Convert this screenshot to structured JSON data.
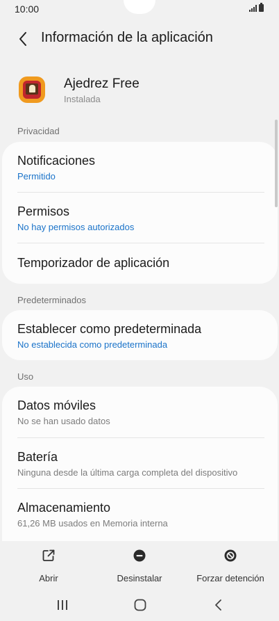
{
  "status_bar": {
    "time": "10:00"
  },
  "header": {
    "title": "Información de la aplicación"
  },
  "app": {
    "name": "Ajedrez Free",
    "status": "Instalada"
  },
  "sections": {
    "privacy": "Privacidad",
    "defaults": "Predeterminados",
    "usage": "Uso"
  },
  "privacy_items": [
    {
      "title": "Notificaciones",
      "subtitle": "Permitido"
    },
    {
      "title": "Permisos",
      "subtitle": "No hay permisos autorizados"
    },
    {
      "title": "Temporizador de aplicación"
    }
  ],
  "default_items": [
    {
      "title": "Establecer como predeterminada",
      "subtitle": "No establecida como predeterminada"
    }
  ],
  "usage_items": [
    {
      "title": "Datos móviles",
      "subtitle": "No se han usado datos"
    },
    {
      "title": "Batería",
      "subtitle": "Ninguna desde la última carga completa del dispositivo"
    },
    {
      "title": "Almacenamiento",
      "subtitle": "61,26 MB usados en Memoria interna"
    }
  ],
  "actions": {
    "open": "Abrir",
    "uninstall": "Desinstalar",
    "force_stop": "Forzar detención"
  },
  "colors": {
    "accent": "#1a73c9",
    "background": "#f1f1f1",
    "card": "#fcfcfc"
  }
}
